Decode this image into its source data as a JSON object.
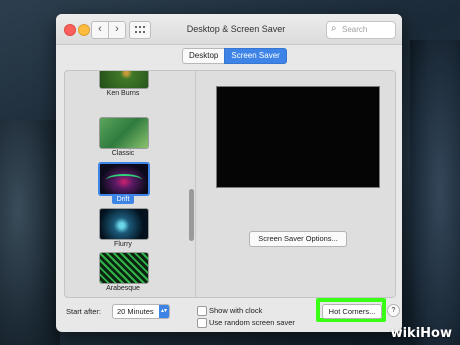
{
  "window": {
    "title": "Desktop & Screen Saver",
    "search_placeholder": "Search"
  },
  "nav": {
    "back_icon": "‹",
    "forward_icon": "›"
  },
  "tabs": [
    {
      "label": "Desktop",
      "active": false
    },
    {
      "label": "Screen Saver",
      "active": true
    }
  ],
  "savers": [
    {
      "label": "Ken Burns",
      "selected": false,
      "icon": "ken-burns-thumbnail"
    },
    {
      "label": "Classic",
      "selected": false,
      "icon": "classic-thumbnail"
    },
    {
      "label": "Drift",
      "selected": true,
      "icon": "drift-thumbnail"
    },
    {
      "label": "Flurry",
      "selected": false,
      "icon": "flurry-thumbnail"
    },
    {
      "label": "Arabesque",
      "selected": false,
      "icon": "arabesque-thumbnail"
    }
  ],
  "preview": {
    "options_button": "Screen Saver Options..."
  },
  "bottom": {
    "start_after_label": "Start after:",
    "start_after_value": "20 Minutes",
    "show_with_clock": "Show with clock",
    "random_saver": "Use random screen saver",
    "hot_corners_button": "Hot Corners...",
    "help": "?"
  },
  "colors": {
    "accent": "#3d84e6",
    "highlight": "#39ff14"
  },
  "watermark": {
    "wiki": "wiki",
    "how": "How"
  }
}
